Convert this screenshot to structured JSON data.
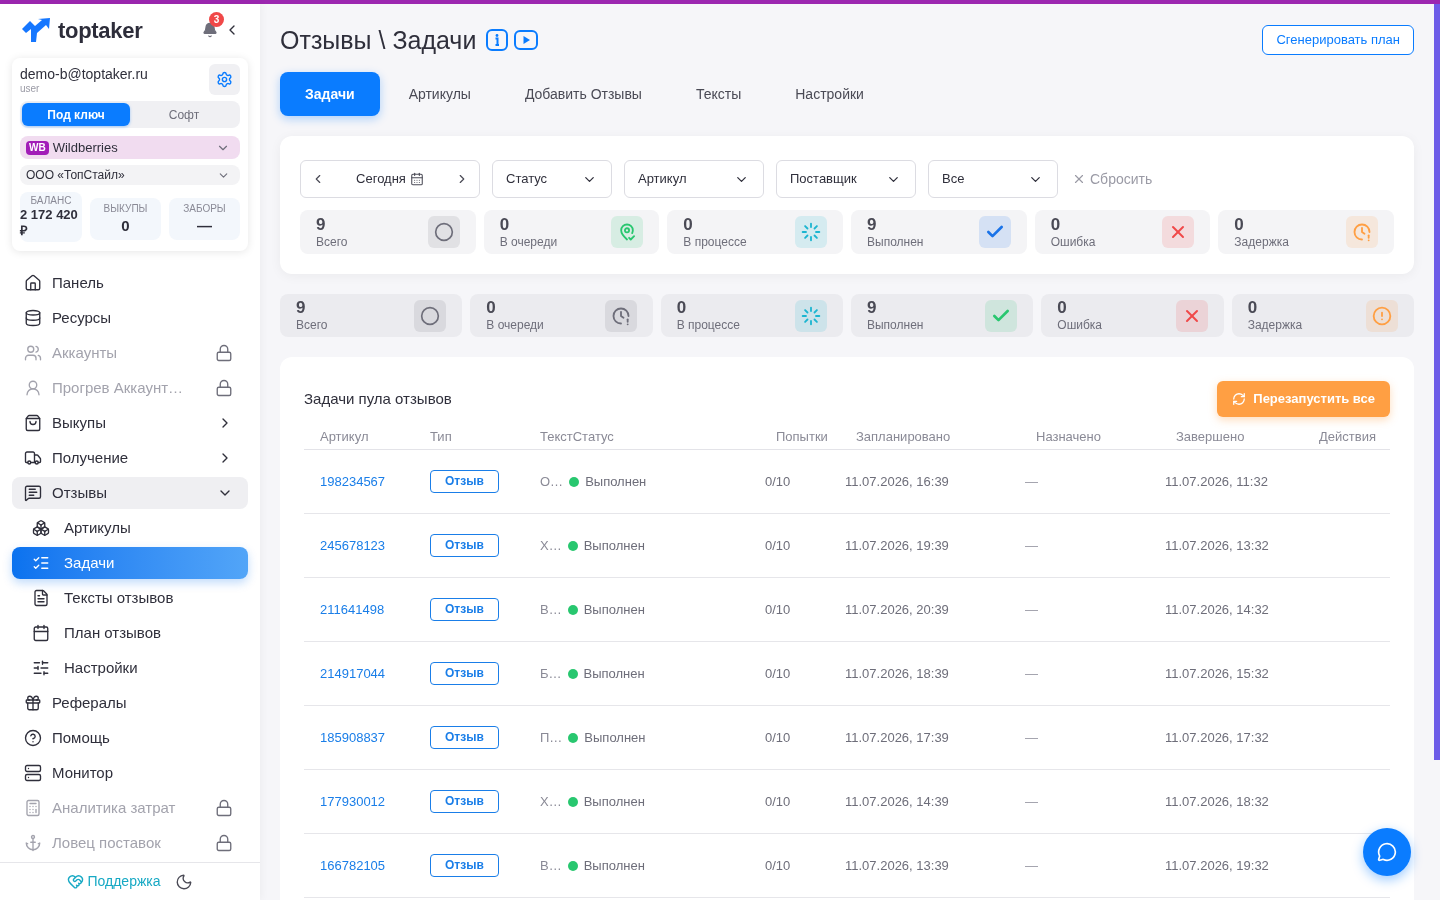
{
  "sidebar": {
    "logo": "toptaker",
    "notifications_count": "3",
    "account": {
      "email": "demo-b@toptaker.ru",
      "role": "user"
    },
    "mode_tabs": [
      {
        "label": "Под ключ",
        "selected": true
      },
      {
        "label": "Софт",
        "selected": false
      }
    ],
    "marketplace": {
      "badge": "WB",
      "label": "Wildberries"
    },
    "organization": "ООО «ТопСтайл»",
    "stats": [
      {
        "label": "БАЛАНС",
        "value": "2 172 420 ₽"
      },
      {
        "label": "ВЫКУПЫ",
        "value": "0"
      },
      {
        "label": "ЗАБОРЫ",
        "value": "—"
      }
    ],
    "nav": [
      {
        "label": "Панель",
        "selected": false,
        "disabled": false
      },
      {
        "label": "Ресурсы",
        "selected": false,
        "disabled": false
      },
      {
        "label": "Аккаунты",
        "selected": false,
        "disabled": true
      },
      {
        "label": "Прогрев Аккаунт…",
        "selected": false,
        "disabled": true
      },
      {
        "label": "Выкупы",
        "expanded": false,
        "selected": false,
        "disabled": false
      },
      {
        "label": "Получение",
        "expanded": false,
        "selected": false,
        "disabled": false
      },
      {
        "label": "Отзывы",
        "expanded": true,
        "selected": false,
        "disabled": false,
        "children": [
          {
            "label": "Артикулы",
            "selected": false,
            "disabled": false
          },
          {
            "label": "Задачи",
            "selected": true,
            "disabled": false
          },
          {
            "label": "Тексты отзывов",
            "selected": false,
            "disabled": false
          },
          {
            "label": "План отзывов",
            "selected": false,
            "disabled": false
          },
          {
            "label": "Настройки",
            "selected": false,
            "disabled": false
          }
        ]
      },
      {
        "label": "Рефералы",
        "selected": false,
        "disabled": false
      },
      {
        "label": "Помощь",
        "selected": false,
        "disabled": false
      },
      {
        "label": "Монитор",
        "selected": false,
        "disabled": false
      },
      {
        "label": "Аналитика затрат",
        "selected": false,
        "disabled": true
      },
      {
        "label": "Ловец поставок",
        "selected": false,
        "disabled": true
      }
    ],
    "support": "Поддержка"
  },
  "page": {
    "title": "Отзывы \\ Задачи",
    "generate_button": "Сгенерировать план"
  },
  "tabs": [
    {
      "label": "Задачи",
      "selected": true
    },
    {
      "label": "Артикулы",
      "selected": false
    },
    {
      "label": "Добавить Отзывы",
      "selected": false
    },
    {
      "label": "Тексты",
      "selected": false
    },
    {
      "label": "Настройки",
      "selected": false
    }
  ],
  "filter_panel": {
    "date": "Сегодня",
    "selects": [
      "Статус",
      "Артикул",
      "Поставщик",
      "Все"
    ],
    "reset": "Сбросить",
    "stats": [
      {
        "value": "9",
        "label": "Всего",
        "color": "#6e6e7a"
      },
      {
        "value": "0",
        "label": "В очереди",
        "color": "#28c76f"
      },
      {
        "value": "0",
        "label": "В процессе",
        "color": "#1cb5d0"
      },
      {
        "value": "9",
        "label": "Выполнен",
        "color": "#1a73e8"
      },
      {
        "value": "0",
        "label": "Ошибка",
        "color": "#f04848"
      },
      {
        "value": "0",
        "label": "Задержка",
        "color": "#ff9f43"
      }
    ]
  },
  "summary": [
    {
      "value": "9",
      "label": "Всего",
      "color": "#6e6e7a"
    },
    {
      "value": "0",
      "label": "В очереди",
      "color": "#6e6e7a"
    },
    {
      "value": "0",
      "label": "В процессе",
      "color": "#1cb5d0"
    },
    {
      "value": "9",
      "label": "Выполнен",
      "color": "#28c76f"
    },
    {
      "value": "0",
      "label": "Ошибка",
      "color": "#f04848"
    },
    {
      "value": "0",
      "label": "Задержка",
      "color": "#ff9f43"
    }
  ],
  "tasks": {
    "title": "Задачи пула отзывов",
    "restart_button": "Перезапустить все",
    "columns": [
      "Артикул",
      "Тип",
      "Текст",
      "Статус",
      "Попытки",
      "Запланировано",
      "Назначено",
      "Завершено",
      "Действия"
    ],
    "rows": [
      {
        "article": "198234567",
        "type": "Отзыв",
        "text": "О…",
        "status": "Выполнен",
        "color": "#28c76f",
        "attempts": "0/10",
        "scheduled": "11.07.2026, 16:39",
        "assigned": "—",
        "completed": "11.07.2026, 11:32"
      },
      {
        "article": "245678123",
        "type": "Отзыв",
        "text": "Х…",
        "status": "Выполнен",
        "color": "#28c76f",
        "attempts": "0/10",
        "scheduled": "11.07.2026, 19:39",
        "assigned": "—",
        "completed": "11.07.2026, 13:32"
      },
      {
        "article": "211641498",
        "type": "Отзыв",
        "text": "В…",
        "status": "Выполнен",
        "color": "#28c76f",
        "attempts": "0/10",
        "scheduled": "11.07.2026, 20:39",
        "assigned": "—",
        "completed": "11.07.2026, 14:32"
      },
      {
        "article": "214917044",
        "type": "Отзыв",
        "text": "Б…",
        "status": "Выполнен",
        "color": "#28c76f",
        "attempts": "0/10",
        "scheduled": "11.07.2026, 18:39",
        "assigned": "—",
        "completed": "11.07.2026, 15:32"
      },
      {
        "article": "185908837",
        "type": "Отзыв",
        "text": "П…",
        "status": "Выполнен",
        "color": "#28c76f",
        "attempts": "0/10",
        "scheduled": "11.07.2026, 17:39",
        "assigned": "—",
        "completed": "11.07.2026, 17:32"
      },
      {
        "article": "177930012",
        "type": "Отзыв",
        "text": "Х…",
        "status": "Выполнен",
        "color": "#28c76f",
        "attempts": "0/10",
        "scheduled": "11.07.2026, 14:39",
        "assigned": "—",
        "completed": "11.07.2026, 18:32"
      },
      {
        "article": "166782105",
        "type": "Отзыв",
        "text": "В…",
        "status": "Выполнен",
        "color": "#28c76f",
        "attempts": "0/10",
        "scheduled": "11.07.2026, 13:39",
        "assigned": "—",
        "completed": "11.07.2026, 19:32"
      }
    ]
  }
}
